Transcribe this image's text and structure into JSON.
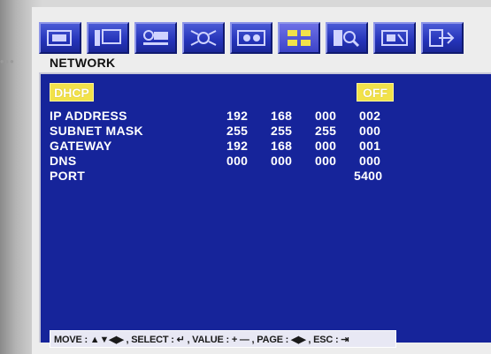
{
  "section_title": "NETWORK",
  "dhcp": {
    "label": "DHCP",
    "value": "OFF"
  },
  "fields": [
    {
      "label": "IP ADDRESS",
      "octets": [
        "192",
        "168",
        "000",
        "002"
      ]
    },
    {
      "label": "SUBNET MASK",
      "octets": [
        "255",
        "255",
        "255",
        "000"
      ]
    },
    {
      "label": "GATEWAY",
      "octets": [
        "192",
        "168",
        "000",
        "001"
      ]
    },
    {
      "label": "DNS",
      "octets": [
        "000",
        "000",
        "000",
        "000"
      ]
    }
  ],
  "port": {
    "label": "PORT",
    "value": "5400"
  },
  "hint": "MOVE : ▲▼◀▶ , SELECT : ↵ , VALUE : + — , PAGE : ◀▶ , ESC : ⇥",
  "toolbar_icons": [
    "display-icon",
    "monitor-icon",
    "camera-icon",
    "motion-icon",
    "settings-icon",
    "network-icon",
    "search-icon",
    "system-icon",
    "exit-icon"
  ],
  "colors": {
    "panel": "#16249a",
    "pill": "#f2e24a",
    "text": "#ffffff"
  }
}
